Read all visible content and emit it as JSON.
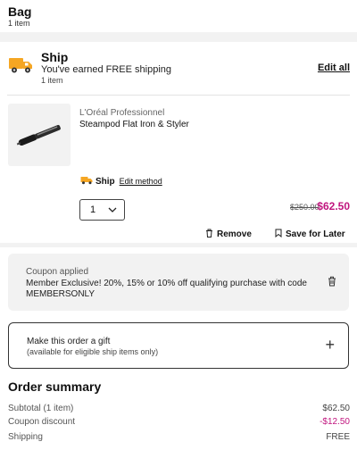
{
  "bag": {
    "title": "Bag",
    "count": "1 item"
  },
  "ship": {
    "title": "Ship",
    "free_msg": "You've earned FREE shipping",
    "count": "1 item",
    "edit_all": "Edit all",
    "icon": "truck-icon"
  },
  "product": {
    "brand": "L'Oréal Professionnel",
    "name": "Steampod Flat Iron & Styler",
    "ship_method_label": "Ship",
    "edit_method": "Edit method",
    "quantity": "1",
    "price_original": "$250.00",
    "price_sale": "$62.50",
    "remove": "Remove",
    "save_later": "Save for Later"
  },
  "coupon": {
    "title": "Coupon applied",
    "text": "Member Exclusive! 20%, 15% or 10% off qualifying purchase with code MEMBERSONLY"
  },
  "gift": {
    "title": "Make this order a gift",
    "subtitle": "(available for eligible ship items only)",
    "plus": "+"
  },
  "summary": {
    "title": "Order summary",
    "rows": [
      {
        "label": "Subtotal (1 item)",
        "value": "$62.50"
      },
      {
        "label": "Coupon discount",
        "value": "-$12.50"
      },
      {
        "label": "Shipping",
        "value": "FREE"
      }
    ]
  },
  "colors": {
    "accent": "#c0157e",
    "truck": "#f5a623",
    "band": "#f2f2f2"
  }
}
